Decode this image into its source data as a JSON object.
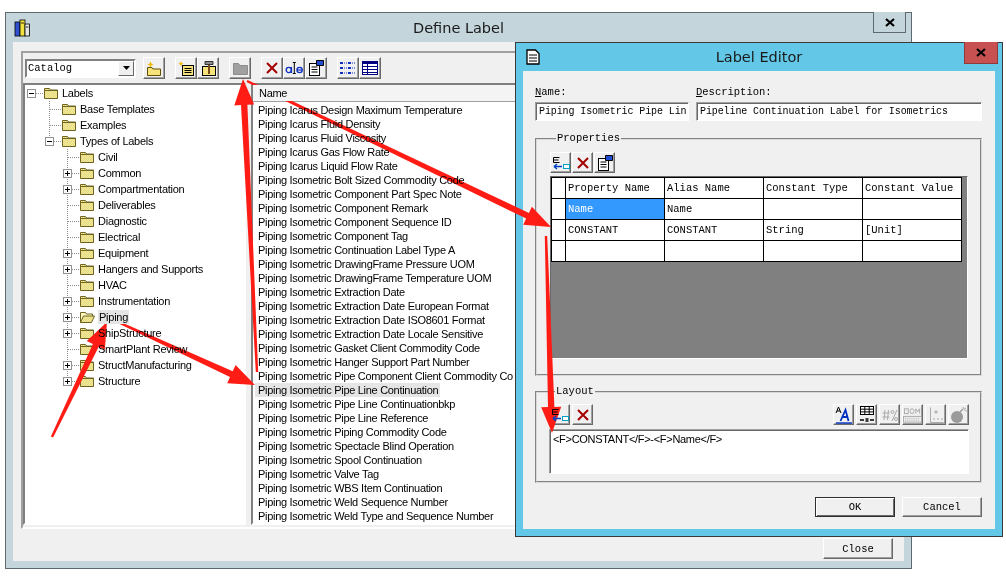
{
  "define_label_window": {
    "title": "Define Label",
    "toolbar": {
      "catalog_dropdown": {
        "value": "Catalog"
      },
      "button_groups": [
        [
          {
            "disabled": false
          }
        ],
        [
          {
            "disabled": false
          },
          {
            "disabled": false
          }
        ],
        [
          {
            "disabled": true
          }
        ],
        [
          {
            "disabled": false
          },
          {
            "disabled": false
          },
          {
            "disabled": false
          }
        ],
        [
          {
            "disabled": false
          },
          {
            "disabled": false
          }
        ]
      ]
    },
    "tree": [
      {
        "label": "Labels",
        "expanded": true,
        "selected": false,
        "children": [
          {
            "label": "Base Templates",
            "selected": false
          },
          {
            "label": "Examples",
            "selected": false
          },
          {
            "label": "Types of Labels",
            "expanded": true,
            "selected": false,
            "children": [
              {
                "label": "Civil",
                "selected": false
              },
              {
                "label": "Common",
                "expanded": false,
                "selected": false
              },
              {
                "label": "Compartmentation",
                "expanded": false,
                "selected": false
              },
              {
                "label": "Deliverables",
                "selected": false
              },
              {
                "label": "Diagnostic",
                "selected": false
              },
              {
                "label": "Electrical",
                "selected": false
              },
              {
                "label": "Equipment",
                "expanded": false,
                "selected": false
              },
              {
                "label": "Hangers and Supports",
                "expanded": false,
                "selected": false
              },
              {
                "label": "HVAC",
                "selected": false
              },
              {
                "label": "Instrumentation",
                "expanded": false,
                "selected": false
              },
              {
                "label": "Piping",
                "expanded": false,
                "selected": true
              },
              {
                "label": "ShipStructure",
                "expanded": false,
                "selected": false
              },
              {
                "label": "SmartPlant Review",
                "selected": false
              },
              {
                "label": "StructManufacturing",
                "expanded": false,
                "selected": false
              },
              {
                "label": "Structure",
                "expanded": false,
                "selected": false
              }
            ]
          }
        ]
      }
    ],
    "list": {
      "columns": [
        "Name"
      ],
      "items": [
        {
          "label": "Piping Icarus Design Maximum Temperature",
          "selected": false
        },
        {
          "label": "Piping Icarus Fluid Density",
          "selected": false
        },
        {
          "label": "Piping Icarus Fluid Viscosity",
          "selected": false
        },
        {
          "label": "Piping Icarus Gas Flow Rate",
          "selected": false
        },
        {
          "label": "Piping Icarus Liquid Flow Rate",
          "selected": false
        },
        {
          "label": "Piping Isometric Bolt Sized Commodity Code",
          "selected": false
        },
        {
          "label": "Piping Isometric Component Part Spec Note",
          "selected": false
        },
        {
          "label": "Piping Isometric Component Remark",
          "selected": false
        },
        {
          "label": "Piping Isometric Component Sequence ID",
          "selected": false
        },
        {
          "label": "Piping Isometric Component Tag",
          "selected": false
        },
        {
          "label": "Piping Isometric Continuation Label Type A",
          "selected": false
        },
        {
          "label": "Piping Isometric DrawingFrame Pressure UOM",
          "selected": false
        },
        {
          "label": "Piping Isometric DrawingFrame Temperature UOM",
          "selected": false
        },
        {
          "label": "Piping Isometric Extraction Date",
          "selected": false
        },
        {
          "label": "Piping Isometric Extraction Date European Format",
          "selected": false
        },
        {
          "label": "Piping Isometric Extraction Date ISO8601 Format",
          "selected": false
        },
        {
          "label": "Piping Isometric Extraction Date Locale Sensitive",
          "selected": false
        },
        {
          "label": "Piping Isometric Gasket Client Commodity Code",
          "selected": false
        },
        {
          "label": "Piping Isometric Hanger Support Part Number",
          "selected": false
        },
        {
          "label": "Piping Isometric Pipe Component Client Commodity Co",
          "selected": false
        },
        {
          "label": "Piping Isometric Pipe Line Continuation",
          "selected": true
        },
        {
          "label": "Piping Isometric Pipe Line Continuationbkp",
          "selected": false
        },
        {
          "label": "Piping Isometric Pipe Line Reference",
          "selected": false
        },
        {
          "label": "Piping Isometric Piping Commodity Code",
          "selected": false
        },
        {
          "label": "Piping Isometric Spectacle Blind Operation",
          "selected": false
        },
        {
          "label": "Piping Isometric Spool Continuation",
          "selected": false
        },
        {
          "label": "Piping Isometric Valve Tag",
          "selected": false
        },
        {
          "label": "Piping Isometric WBS Item Continuation",
          "selected": false
        },
        {
          "label": "Piping Isometric Weld Sequence Number",
          "selected": false
        },
        {
          "label": "Piping Isometric Weld Type and Sequence Number",
          "selected": false
        }
      ]
    },
    "buttons": [
      {
        "label": "Close"
      }
    ]
  },
  "label_editor_window": {
    "title": "Label Editor",
    "name_field": {
      "label": "Name:",
      "value": "Piping Isometric Pipe Lin"
    },
    "description_field": {
      "label": "Description:",
      "value": "Pipeline Continuation Label for Isometrics"
    },
    "properties": {
      "title": "Properties",
      "toolbar": [
        {
          "disabled": false
        },
        {
          "disabled": false
        },
        {
          "disabled": false
        }
      ],
      "columns": [
        "Property Name",
        "Alias Name",
        "Constant Type",
        "Constant Value"
      ],
      "rows": [
        {
          "cells": [
            "Name",
            "Name"
          ],
          "selected": true
        },
        {
          "cells": [
            "CONSTANT",
            "CONSTANT",
            "String",
            "[Unit]"
          ],
          "selected": false
        }
      ]
    },
    "layout": {
      "title": "Layout",
      "toolbar": [
        [
          {
            "disabled": false
          },
          {
            "disabled": false
          }
        ],
        [
          {
            "disabled": false
          },
          {
            "disabled": false
          },
          {
            "disabled": true
          },
          {
            "disabled": true
          },
          {
            "disabled": true
          },
          {
            "disabled": true
          }
        ]
      ],
      "text": "<F>CONSTANT</F>-<F>Name</F>"
    },
    "buttons": [
      {
        "label": "OK",
        "default": true
      },
      {
        "label": "Cancel",
        "default": false
      }
    ]
  }
}
